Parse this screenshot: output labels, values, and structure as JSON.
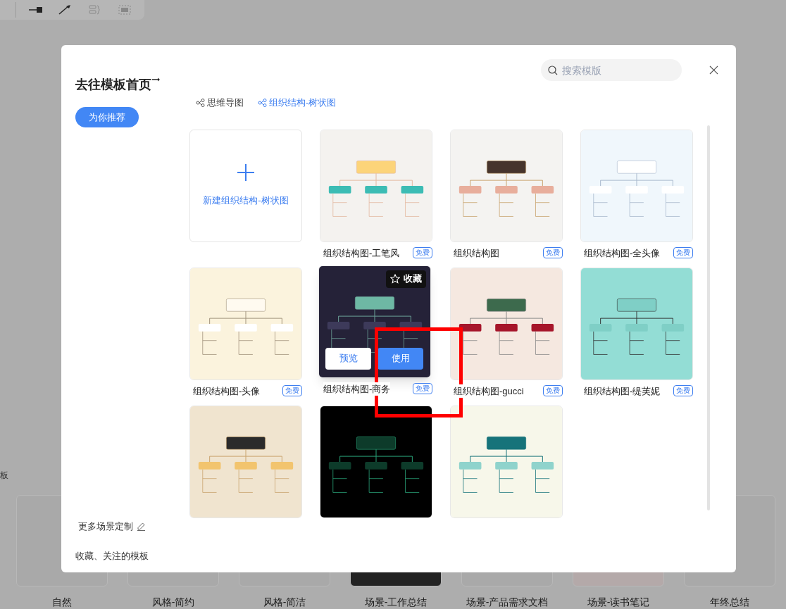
{
  "background": {
    "side_text": "板",
    "templates": [
      {
        "label": "自然"
      },
      {
        "label": "风格-简约"
      },
      {
        "label": "风格-简洁"
      },
      {
        "label": "场景-工作总结"
      },
      {
        "label": "场景-产品需求文档"
      },
      {
        "label": "场景-读书笔记"
      },
      {
        "label": "年终总结"
      }
    ]
  },
  "modal": {
    "home_link": "去往模板首页",
    "recommend_button": "为你推荐",
    "more_scenes": "更多场景定制",
    "favorites_link": "收藏、关注的模板",
    "search": {
      "placeholder": "搜索模版"
    },
    "tabs": [
      {
        "label": "思维导图",
        "selected": false
      },
      {
        "label": "组织结构-树状图",
        "selected": true
      }
    ],
    "new_card": {
      "label": "新建组织结构-树状图"
    },
    "templates": [
      {
        "title": "组织结构图-工笔风",
        "badge": "免费",
        "hovered": false
      },
      {
        "title": "组织结构图",
        "badge": "免费",
        "hovered": false
      },
      {
        "title": "组织结构图-全头像",
        "badge": "免费",
        "hovered": false
      },
      {
        "title": "组织结构图-头像",
        "badge": "免费",
        "hovered": false
      },
      {
        "title": "组织结构图-商务",
        "badge": "免费",
        "hovered": true
      },
      {
        "title": "组织结构图-gucci",
        "badge": "免费",
        "hovered": false
      },
      {
        "title": "组织结构图-缇芙妮",
        "badge": "免费",
        "hovered": false
      },
      {
        "kind": "picture",
        "hovered": false
      },
      {
        "kind": "picture",
        "hovered": false
      },
      {
        "kind": "picture",
        "hovered": false
      }
    ],
    "hover_actions": {
      "favorite": "收藏",
      "preview": "预览",
      "use": "使用"
    }
  },
  "annotation": {
    "kind": "frame"
  }
}
